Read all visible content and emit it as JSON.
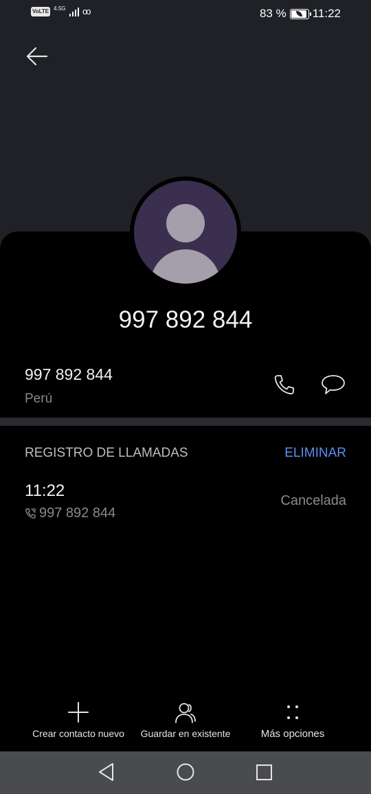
{
  "status_bar": {
    "volte": "VoLTE",
    "network": "4.5G",
    "battery": "83 %",
    "time": "11:22"
  },
  "header": {
    "back_icon": "arrow-left-icon"
  },
  "contact": {
    "title": "997 892 844",
    "avatar_icon": "default-person-avatar"
  },
  "phone": {
    "number": "997 892 844",
    "country": "Perú",
    "call_icon": "phone-icon",
    "message_icon": "message-bubble-icon"
  },
  "call_log": {
    "header": "REGISTRO DE LLAMADAS",
    "delete_label": "ELIMINAR",
    "accent_color": "#5b8ff0",
    "entries": [
      {
        "time": "11:22",
        "number": "997 892 844",
        "status": "Cancelada"
      }
    ]
  },
  "actions": {
    "create": "Crear contacto nuevo",
    "save_existing": "Guardar en existente",
    "more": "Más opciones"
  },
  "nav": {
    "back_icon": "triangle-back-icon",
    "home_icon": "circle-home-icon",
    "recent_icon": "square-recents-icon"
  }
}
